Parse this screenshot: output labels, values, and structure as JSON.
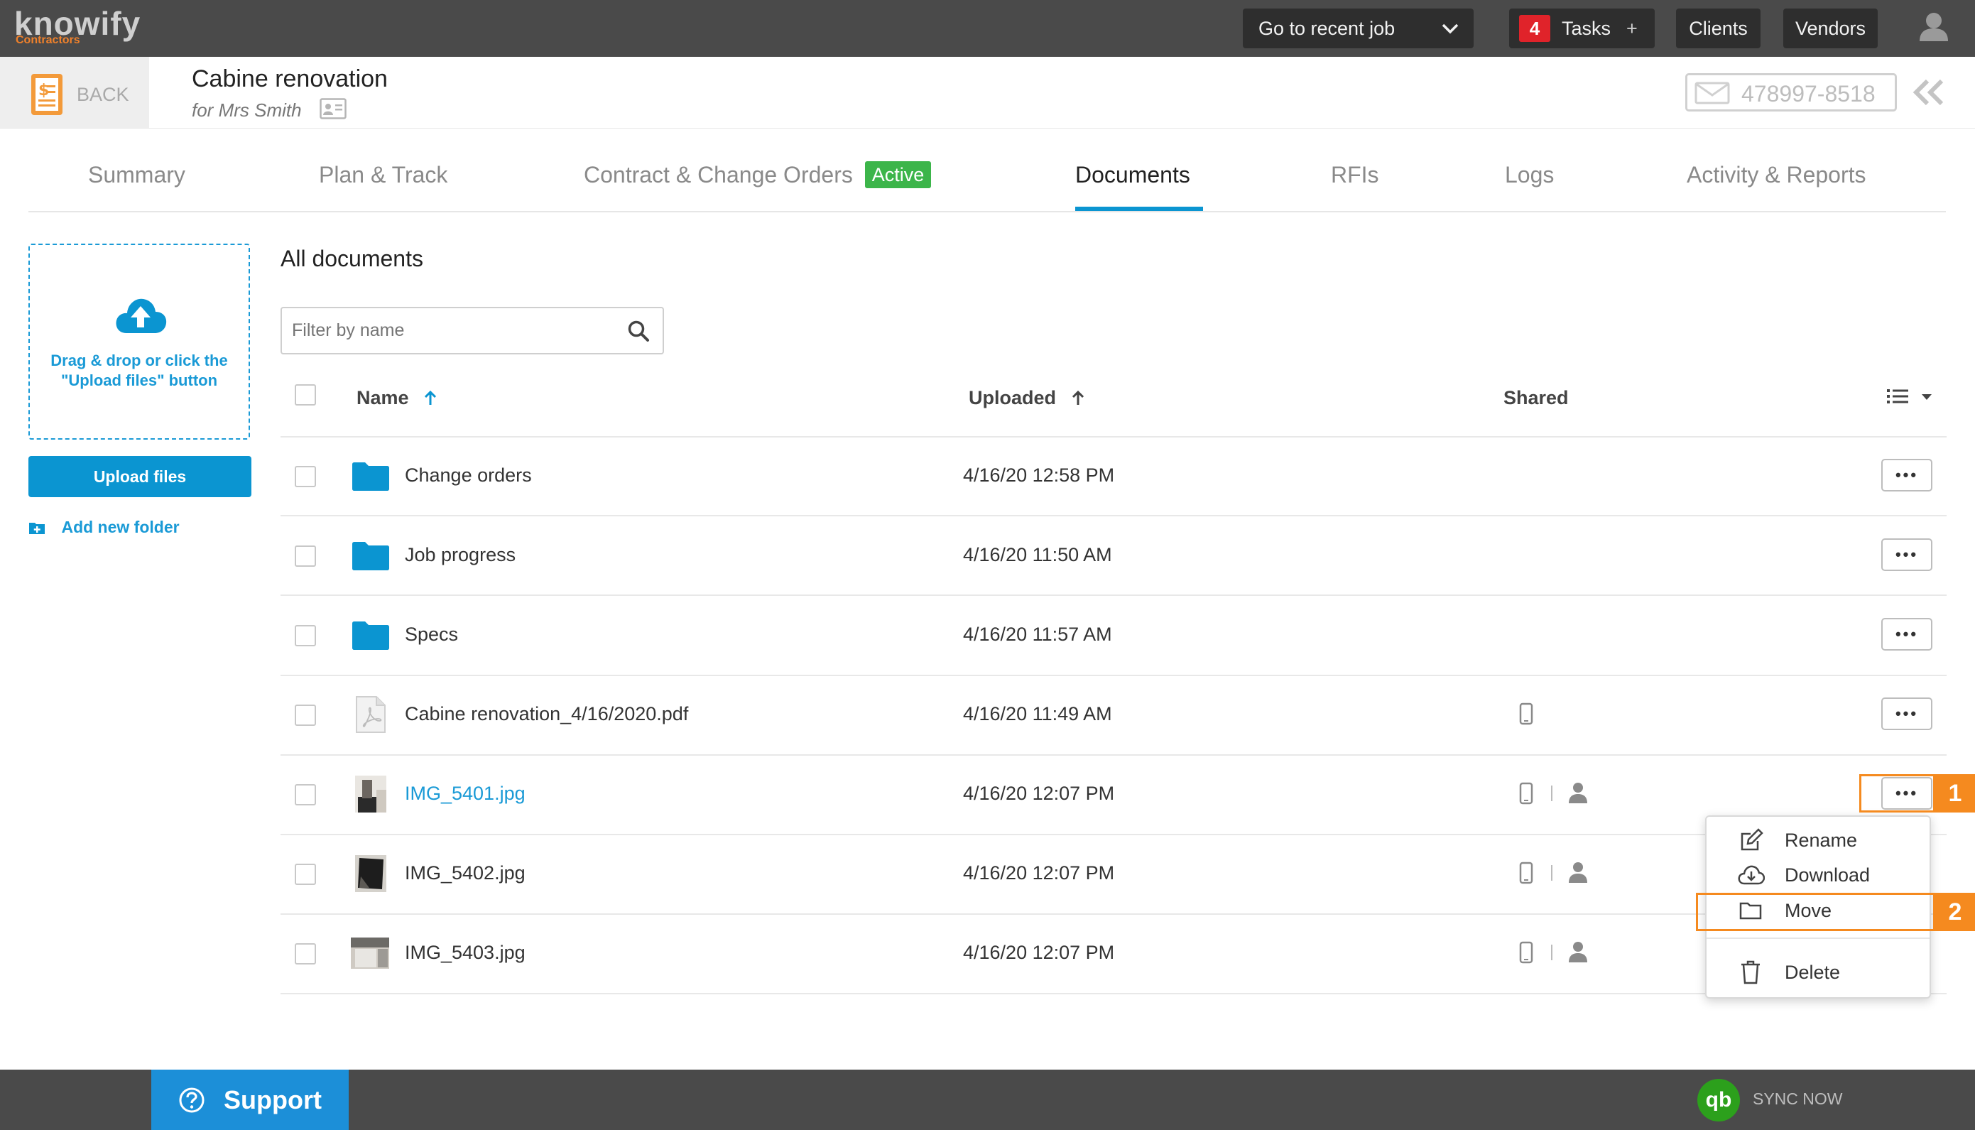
{
  "app": {
    "logo": "knowify",
    "logo_sub": "Contractors"
  },
  "topbar": {
    "recent_job": "Go to recent job",
    "tasks_count": "4",
    "tasks_label": "Tasks",
    "tasks_plus": "+",
    "clients": "Clients",
    "vendors": "Vendors"
  },
  "job": {
    "back": "BACK",
    "title": "Cabine renovation",
    "subtitle": "for Mrs Smith",
    "email_code": "478997-8518"
  },
  "tabs": [
    {
      "label": "Summary"
    },
    {
      "label": "Plan & Track"
    },
    {
      "label": "Contract & Change Orders",
      "badge": "Active"
    },
    {
      "label": "Documents"
    },
    {
      "label": "RFIs"
    },
    {
      "label": "Logs"
    },
    {
      "label": "Activity & Reports"
    }
  ],
  "sidebar": {
    "dropzone_text_1": "Drag & drop or click the",
    "dropzone_text_2": "\"Upload files\" button",
    "upload_button": "Upload files",
    "add_folder": "Add new folder"
  },
  "documents": {
    "heading": "All documents",
    "filter_placeholder": "Filter by name",
    "columns": {
      "name": "Name",
      "uploaded": "Uploaded",
      "shared": "Shared"
    },
    "rows": [
      {
        "name": "Change orders",
        "uploaded": "4/16/20 12:58 PM",
        "type": "folder"
      },
      {
        "name": "Job progress",
        "uploaded": "4/16/20 11:50 AM",
        "type": "folder"
      },
      {
        "name": "Specs",
        "uploaded": "4/16/20 11:57 AM",
        "type": "folder"
      },
      {
        "name": "Cabine renovation_4/16/2020.pdf",
        "uploaded": "4/16/20 11:49 AM",
        "type": "pdf"
      },
      {
        "name": "IMG_5401.jpg",
        "uploaded": "4/16/20 12:07 PM",
        "type": "image"
      },
      {
        "name": "IMG_5402.jpg",
        "uploaded": "4/16/20 12:07 PM",
        "type": "image"
      },
      {
        "name": "IMG_5403.jpg",
        "uploaded": "4/16/20 12:07 PM",
        "type": "image"
      }
    ]
  },
  "context_menu": {
    "rename": "Rename",
    "download": "Download",
    "move": "Move",
    "delete": "Delete"
  },
  "annotations": {
    "step1": "1",
    "step2": "2"
  },
  "footer": {
    "support": "Support",
    "sync": "SYNC NOW",
    "qb": "qb"
  },
  "colors": {
    "accent": "#0b95d1",
    "annotation": "#f58a1f",
    "active_badge": "#3cb54a",
    "topbar": "#4a4a4a"
  }
}
